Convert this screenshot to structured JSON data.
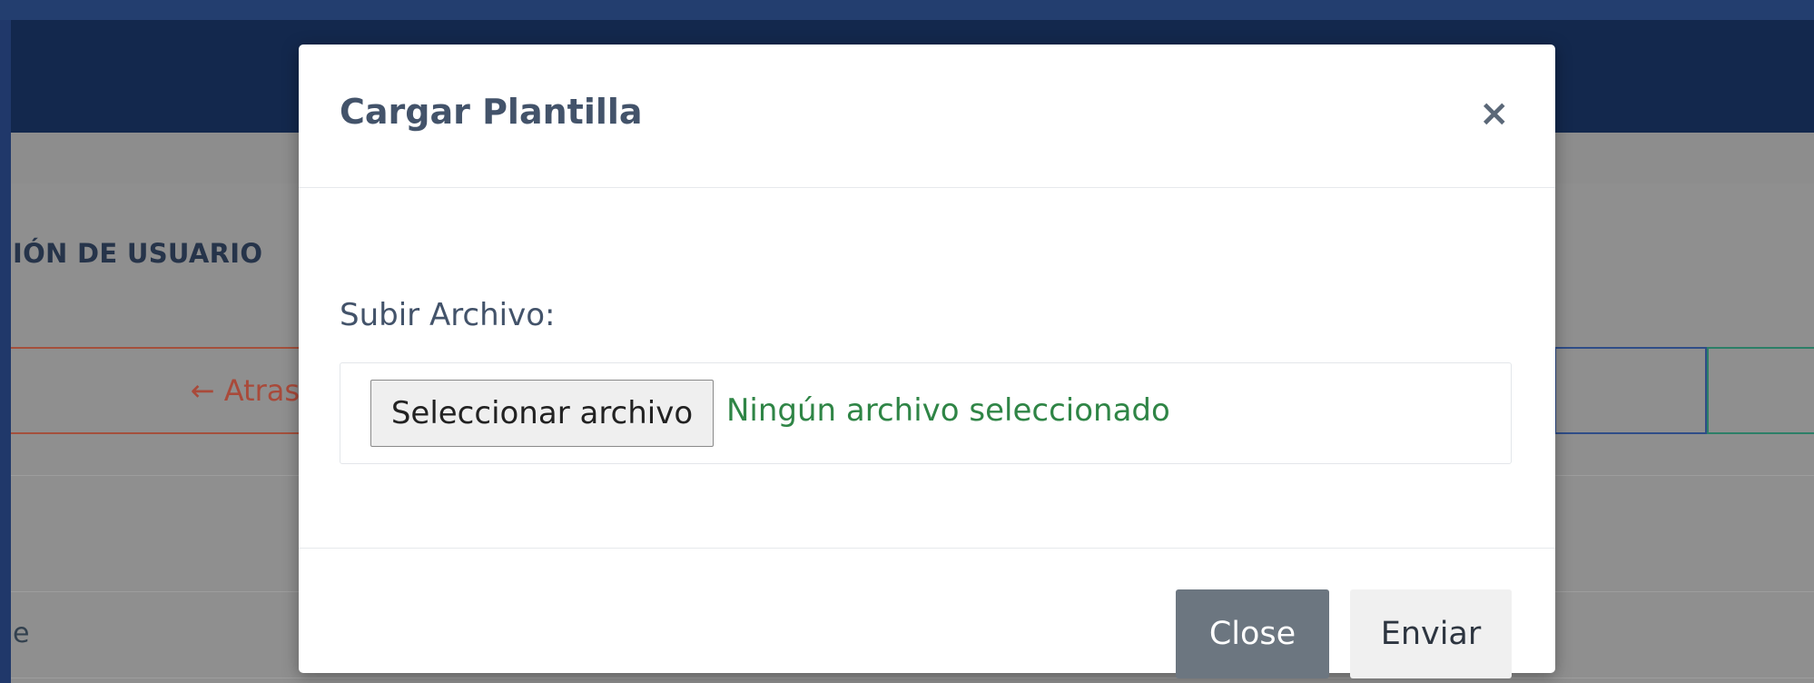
{
  "background": {
    "section_title": "IÓN DE USUARIO",
    "back_button": "← Atras",
    "row_fragment": "e"
  },
  "modal": {
    "title": "Cargar Plantilla",
    "close_symbol": "×",
    "upload_label": "Subir Archivo:",
    "file_button": "Seleccionar archivo",
    "file_status": "Ningún archivo seleccionado",
    "footer": {
      "close_label": "Close",
      "send_label": "Enviar"
    }
  },
  "colors": {
    "navbar": "#13284d",
    "overlay": "#8f8f8f",
    "close_button": "#6c7680",
    "file_status": "#2f8546"
  }
}
